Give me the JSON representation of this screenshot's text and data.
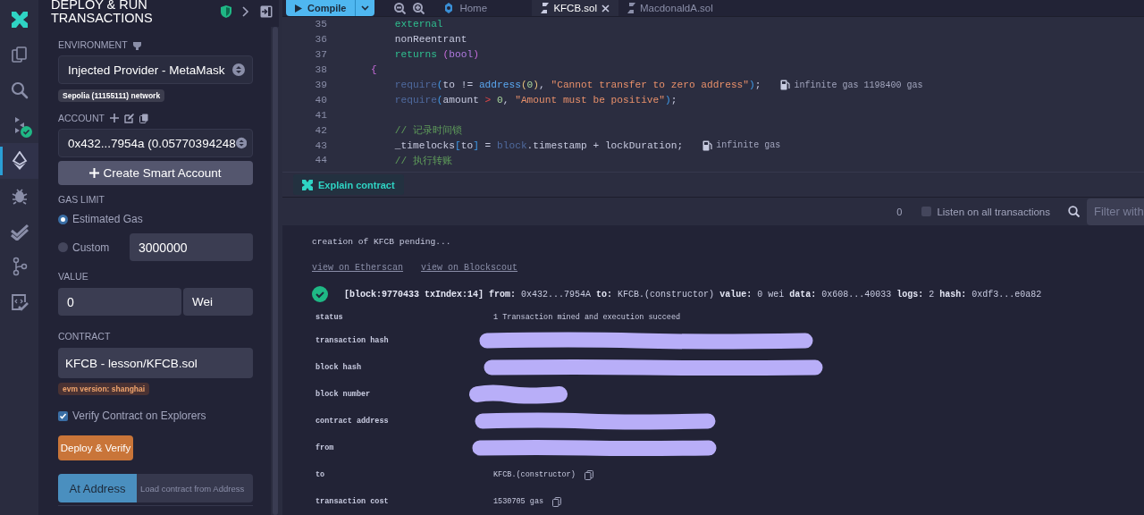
{
  "activity_bar": {
    "items": [
      {
        "kind": "logo",
        "selected": false,
        "badge": false
      },
      {
        "kind": "files",
        "selected": false,
        "badge": false
      },
      {
        "kind": "search",
        "selected": false,
        "badge": false
      },
      {
        "kind": "compiler",
        "selected": false,
        "badge": true
      },
      {
        "kind": "deploy",
        "selected": true,
        "badge": false
      },
      {
        "kind": "debugger",
        "selected": false,
        "badge": false
      },
      {
        "kind": "tests",
        "selected": false,
        "badge": false
      },
      {
        "kind": "git",
        "selected": false,
        "badge": false
      },
      {
        "kind": "verify",
        "selected": false,
        "badge": false
      }
    ]
  },
  "deploy": {
    "title": "DEPLOY & RUN TRANSACTIONS",
    "environment": {
      "label": "ENVIRONMENT",
      "value": "Injected Provider - MetaMask",
      "network": "Sepolia (11155111) network"
    },
    "account": {
      "label": "ACCOUNT",
      "value": "0x432...7954a (0.05770394248",
      "create_button": "Create Smart Account"
    },
    "gas_limit": {
      "label": "GAS LIMIT",
      "options": [
        {
          "label": "Estimated Gas",
          "selected": true
        },
        {
          "label": "Custom",
          "selected": false
        }
      ],
      "custom_value": "3000000"
    },
    "value": {
      "label": "VALUE",
      "amount": "0",
      "unit": "Wei"
    },
    "contract": {
      "label": "CONTRACT",
      "value": "KFCB - lesson/KFCB.sol",
      "evm_badge": "evm version: shanghai",
      "verify": {
        "label": "Verify Contract on Explorers",
        "checked": true
      },
      "deploy_button": "Deploy & Verify"
    },
    "at_address": {
      "button": "At Address",
      "placeholder": "Load contract from Address"
    }
  },
  "editor": {
    "compile_button": "Compile",
    "tabs": [
      {
        "label": "Home",
        "kind": "home",
        "selected": false
      },
      {
        "label": "KFCB.sol",
        "kind": "file",
        "selected": true
      },
      {
        "label": "MacdonaldA.sol",
        "kind": "file",
        "selected": false
      }
    ],
    "lines": [
      {
        "number": "35",
        "tokens": [
          {
            "text": "    external",
            "kind": "keyword"
          }
        ]
      },
      {
        "number": "36",
        "tokens": [
          {
            "text": "    nonReentrant",
            "kind": "plain"
          }
        ]
      },
      {
        "number": "37",
        "tokens": [
          {
            "text": "    returns ",
            "kind": "keyword"
          },
          {
            "text": "(",
            "kind": "paren"
          },
          {
            "text": "bool",
            "kind": "type"
          },
          {
            "text": ")",
            "kind": "paren"
          }
        ]
      },
      {
        "number": "38",
        "tokens": [
          {
            "text": "{",
            "kind": "paren"
          }
        ]
      },
      {
        "number": "39",
        "tokens": [
          {
            "text": "    require",
            "kind": "function"
          },
          {
            "text": "(",
            "kind": "bracket"
          },
          {
            "text": "to != ",
            "kind": "plain"
          },
          {
            "text": "address",
            "kind": "builtin"
          },
          {
            "text": "(",
            "kind": "inner"
          },
          {
            "text": "0",
            "kind": "number"
          },
          {
            "text": ")",
            "kind": "inner"
          },
          {
            "text": ", ",
            "kind": "plain"
          },
          {
            "text": "\"Cannot transfer to zero address\"",
            "kind": "string"
          },
          {
            "text": ")",
            "kind": "bracket"
          },
          {
            "text": ";",
            "kind": "plain"
          }
        ],
        "gas": "infinite gas 1198400 gas"
      },
      {
        "number": "40",
        "tokens": [
          {
            "text": "    require",
            "kind": "function"
          },
          {
            "text": "(",
            "kind": "bracket"
          },
          {
            "text": "amount ",
            "kind": "plain"
          },
          {
            "text": "> ",
            "kind": "operator"
          },
          {
            "text": "0",
            "kind": "number"
          },
          {
            "text": ", ",
            "kind": "plain"
          },
          {
            "text": "\"Amount must be positive\"",
            "kind": "string"
          },
          {
            "text": ")",
            "kind": "bracket"
          },
          {
            "text": ";",
            "kind": "plain"
          }
        ]
      },
      {
        "number": "41"
      },
      {
        "number": "42",
        "tokens": [
          {
            "text": "    // 记录时间锁",
            "kind": "comment"
          }
        ]
      },
      {
        "number": "43",
        "tokens": [
          {
            "text": "    _timelocks",
            "kind": "plain"
          },
          {
            "text": "[",
            "kind": "bracket"
          },
          {
            "text": "to",
            "kind": "plain"
          },
          {
            "text": "]",
            "kind": "bracket"
          },
          {
            "text": " = ",
            "kind": "plain"
          },
          {
            "text": "block",
            "kind": "global"
          },
          {
            "text": ".timestamp + lockDuration;",
            "kind": "plain"
          }
        ],
        "gas": "infinite gas"
      },
      {
        "number": "44",
        "tokens": [
          {
            "text": "    // 执行转账",
            "kind": "comment"
          }
        ]
      }
    ]
  },
  "explain_button": "Explain contract",
  "terminal": {
    "count": "0",
    "listen": {
      "label": "Listen on all transactions",
      "checked": false
    },
    "filter_placeholder": "Filter with",
    "log": "creation of KFCB pending...",
    "links": [
      "view on Etherscan",
      "view on Blockscout"
    ],
    "receipt": {
      "success": true,
      "summary": "**[block:9770433 txIndex:14]** **from:** 0x432...7954A **to:** KFCB.(constructor) **value:** 0 wei **data:** 0x608...40033 **logs:** 2 **hash:** 0xdf3...e0a82",
      "rows": [
        {
          "key": "status",
          "value": "1 Transaction mined and execution succeed",
          "redacted": false,
          "copyable": false
        },
        {
          "key": "transaction hash",
          "redacted": true,
          "copyable": false
        },
        {
          "key": "block hash",
          "redacted": true,
          "copyable": false
        },
        {
          "key": "block number",
          "redacted": true,
          "copyable": false
        },
        {
          "key": "contract address",
          "redacted": true,
          "copyable": false
        },
        {
          "key": "from",
          "redacted": true,
          "copyable": false
        },
        {
          "key": "to",
          "value": "KFCB.(constructor)",
          "redacted": false,
          "copyable": true
        },
        {
          "key": "transaction cost",
          "value": "1530705 gas",
          "redacted": false,
          "copyable": true
        }
      ]
    }
  }
}
